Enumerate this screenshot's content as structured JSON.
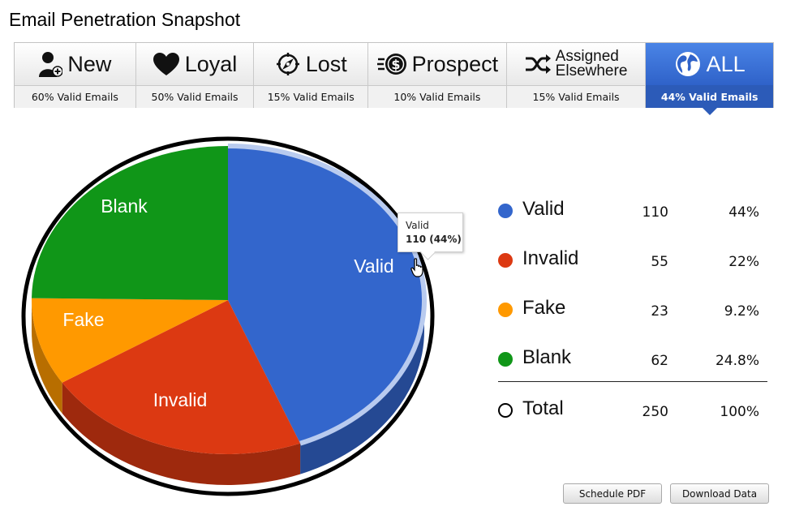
{
  "page": {
    "title": "Email Penetration Snapshot"
  },
  "tabs": [
    {
      "label": "New",
      "sublabel": "60% Valid Emails",
      "icon": "add-user-icon",
      "active": false
    },
    {
      "label": "Loyal",
      "sublabel": "50% Valid Emails",
      "icon": "heart-icon",
      "active": false
    },
    {
      "label": "Lost",
      "sublabel": "15% Valid Emails",
      "icon": "compass-icon",
      "active": false
    },
    {
      "label": "Prospect",
      "sublabel": "10% Valid Emails",
      "icon": "money-icon",
      "active": false
    },
    {
      "label_line1": "Assigned",
      "label_line2": "Elsewhere",
      "sublabel": "15% Valid Emails",
      "icon": "shuffle-icon",
      "active": false
    },
    {
      "label": "ALL",
      "sublabel": "44% Valid Emails",
      "icon": "globe-icon",
      "active": true
    }
  ],
  "chart_data": {
    "type": "pie",
    "slices": [
      {
        "label": "Valid",
        "value": 110,
        "percent": "44%",
        "color": "#3366cc"
      },
      {
        "label": "Invalid",
        "value": 55,
        "percent": "22%",
        "color": "#dc3912"
      },
      {
        "label": "Fake",
        "value": 23,
        "percent": "9.2%",
        "color": "#ff9900"
      },
      {
        "label": "Blank",
        "value": 62,
        "percent": "24.8%",
        "color": "#109618"
      }
    ],
    "total": {
      "label": "Total",
      "value": 250,
      "percent": "100%"
    },
    "tooltip": {
      "title": "Valid",
      "value": "110 (44%)"
    }
  },
  "legend": {
    "rows": [
      {
        "label": "Valid",
        "count": "110",
        "pct": "44%",
        "color": "#3366cc"
      },
      {
        "label": "Invalid",
        "count": "55",
        "pct": "22%",
        "color": "#dc3912"
      },
      {
        "label": "Fake",
        "count": "23",
        "pct": "9.2%",
        "color": "#ff9900"
      },
      {
        "label": "Blank",
        "count": "62",
        "pct": "24.8%",
        "color": "#109618"
      }
    ],
    "total": {
      "label": "Total",
      "count": "250",
      "pct": "100%"
    }
  },
  "buttons": {
    "schedule_pdf": "Schedule PDF",
    "download_data": "Download Data"
  },
  "colors": {
    "accent": "#3d72d9"
  }
}
